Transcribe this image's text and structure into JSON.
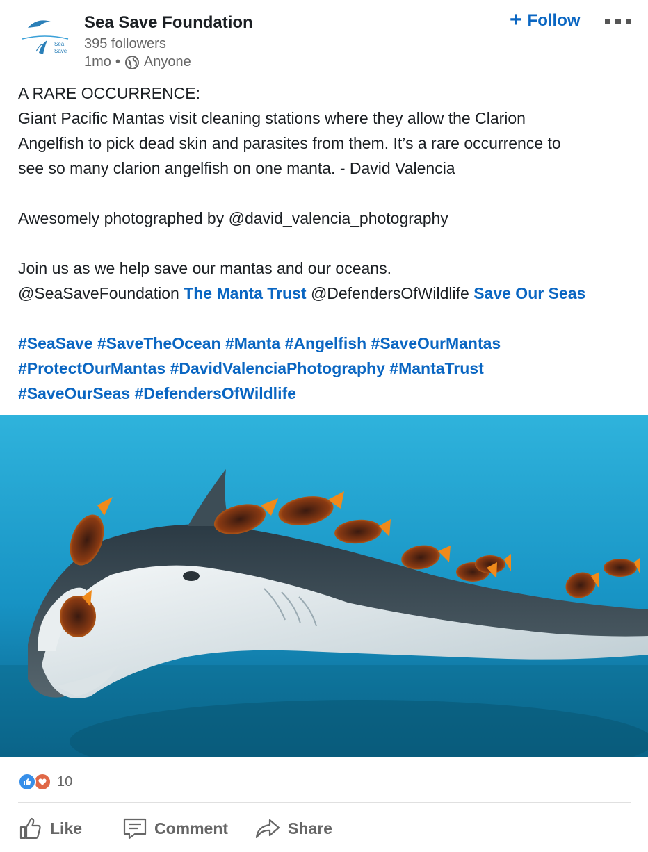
{
  "post": {
    "author": {
      "name": "Sea Save Foundation",
      "followers": "395 followers",
      "time": "1mo",
      "separator": "•",
      "visibility": "Anyone",
      "logo_text_1": "Sea",
      "logo_text_2": "Save"
    },
    "follow_label": "Follow",
    "text": {
      "line1": "A RARE OCCURRENCE:",
      "line2": "Giant Pacific Mantas visit cleaning stations where they allow the Clarion",
      "line3": "Angelfish to pick dead skin and parasites from them. It’s a rare occurrence to",
      "line4": "see so many clarion angelfish on one manta. - David Valencia",
      "line5": "Awesomely photographed by @david_valencia_photography",
      "line6": "Join us as we help save our mantas and our oceans.",
      "mention1": "@SeaSaveFoundation",
      "link1": "The Manta Trust",
      "mention2": "@DefendersOfWildlife",
      "link2": "Save Our Seas"
    },
    "hashtags": {
      "row1": [
        "#SeaSave",
        "#SaveTheOcean",
        "#Manta",
        "#Angelfish",
        "#SaveOurMantas"
      ],
      "row2": [
        "#ProtectOurMantas",
        "#DavidValenciaPhotography",
        "#MantaTrust"
      ],
      "row3": [
        "#SaveOurSeas",
        "#DefendersOfWildlife"
      ]
    },
    "reactions_count": "10",
    "actions": {
      "like": "Like",
      "comment": "Comment",
      "share": "Share"
    }
  },
  "colors": {
    "link": "#0a66c2",
    "secondary_text": "#666666",
    "like_reaction": "#378fe9",
    "love_reaction": "#e06847"
  }
}
